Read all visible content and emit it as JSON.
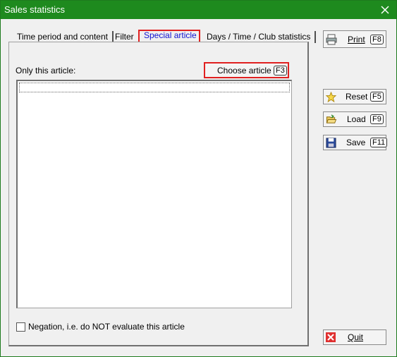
{
  "window": {
    "title": "Sales statistics"
  },
  "tabs": [
    {
      "label": "Time period and content"
    },
    {
      "label": "Filter"
    },
    {
      "label": "Special article"
    },
    {
      "label": "Days / Time / Club statistics"
    }
  ],
  "article": {
    "only_label": "Only this article:",
    "choose_label": "Choose article",
    "choose_key": "F3"
  },
  "negation": {
    "label": "Negation, i.e. do NOT evaluate this article",
    "checked": false
  },
  "toolbar": {
    "print_label": "Print",
    "print_key": "F8",
    "reset_label": "Reset",
    "reset_key": "F5",
    "load_label": "Load",
    "load_key": "F9",
    "save_label": "Save",
    "save_key": "F11",
    "quit_label": "Quit"
  },
  "colors": {
    "titlebar": "#1e8a1e",
    "highlight": "#e02020",
    "active_tab_text": "#1010d0"
  }
}
